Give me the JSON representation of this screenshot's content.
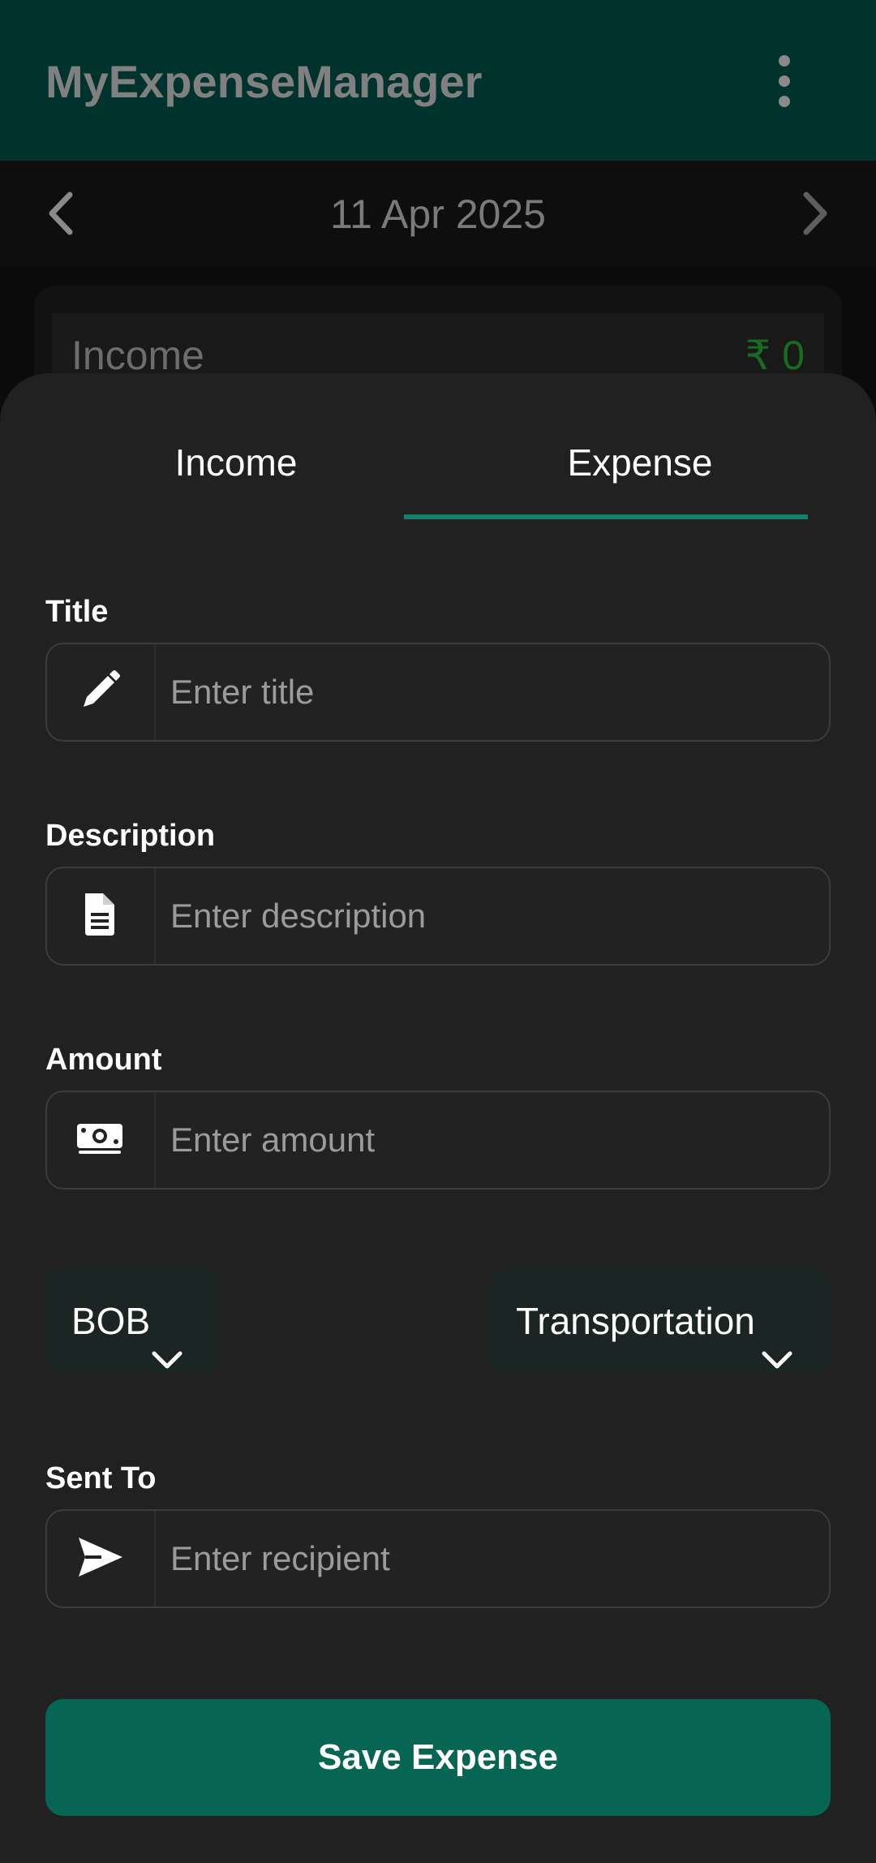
{
  "app_bar": {
    "title": "MyExpenseManager",
    "menu_icon": "more-vert-icon",
    "background": "#00332d"
  },
  "date_nav": {
    "date": "11 Apr 2025",
    "prev_icon": "chevron-left-icon",
    "next_icon": "chevron-right-icon"
  },
  "summary": {
    "label": "Income",
    "value": "₹ 0",
    "value_color": "#1a6b22"
  },
  "sheet": {
    "tabs": [
      {
        "label": "Income",
        "selected": false
      },
      {
        "label": "Expense",
        "selected": true
      }
    ],
    "accent_color": "#12806c",
    "fields": {
      "title": {
        "label": "Title",
        "placeholder": "Enter title",
        "value": "",
        "icon": "pencil-icon"
      },
      "description": {
        "label": "Description",
        "placeholder": "Enter description",
        "value": "",
        "icon": "document-icon"
      },
      "amount": {
        "label": "Amount",
        "placeholder": "Enter amount",
        "value": "",
        "icon": "money-bill-icon"
      },
      "sent_to": {
        "label": "Sent To",
        "placeholder": "Enter recipient",
        "value": "",
        "icon": "send-icon"
      }
    },
    "account_dropdown": {
      "selected": "BOB",
      "icon": "chevron-down-icon"
    },
    "category_dropdown": {
      "selected": "Transportation",
      "icon": "chevron-down-icon"
    },
    "save_button": {
      "label": "Save Expense",
      "color": "#066553"
    }
  }
}
